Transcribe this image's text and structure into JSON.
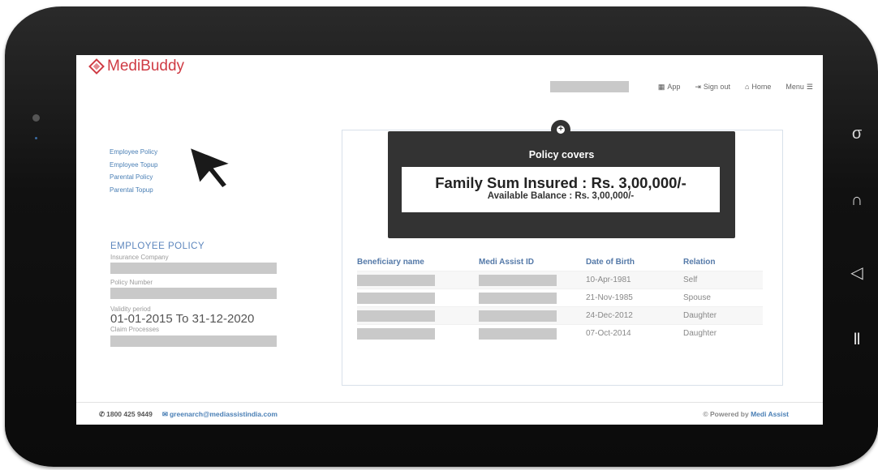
{
  "brand": {
    "name": "MediBuddy",
    "color": "#cf3b44"
  },
  "topnav": {
    "app_label": "App",
    "signout_label": "Sign out",
    "home_label": "Home",
    "menu_label": "Menu"
  },
  "sidebar": {
    "links": [
      "Employee Policy",
      "Employee Topup",
      "Parental Policy",
      "Parental Topup"
    ]
  },
  "employee_policy": {
    "title": "EMPLOYEE POLICY",
    "insurance_label": "Insurance Company",
    "policy_number_label": "Policy Number",
    "validity_label": "Validity period",
    "validity_value": "01-01-2015 To 31-12-2020",
    "claim_label": "Claim Processes"
  },
  "cover": {
    "title": "Policy covers",
    "sum_insured": "Family Sum Insured : Rs. 3,00,000/-",
    "balance": "Available Balance : Rs. 3,00,000/-"
  },
  "table": {
    "headers": [
      "Beneficiary name",
      "Medi Assist ID",
      "Date of Birth",
      "Relation"
    ],
    "rows": [
      {
        "dob": "10-Apr-1981",
        "relation": "Self"
      },
      {
        "dob": "21-Nov-1985",
        "relation": "Spouse"
      },
      {
        "dob": "24-Dec-2012",
        "relation": "Daughter"
      },
      {
        "dob": "07-Oct-2014",
        "relation": "Daughter"
      }
    ]
  },
  "footer": {
    "phone": "1800 425 9449",
    "email": "greenarch@mediassistindia.com",
    "powered_prefix": "© Powered by",
    "powered_brand": "Medi Assist"
  },
  "device_buttons": [
    "search-icon",
    "back-icon",
    "home-icon",
    "menu-icon"
  ]
}
